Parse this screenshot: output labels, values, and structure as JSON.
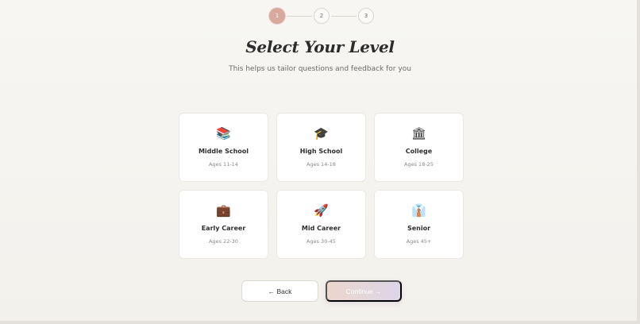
{
  "stepper": {
    "steps": [
      {
        "label": "1",
        "state": "active"
      },
      {
        "label": "2",
        "state": "inactive"
      },
      {
        "label": "3",
        "state": "inactive"
      }
    ]
  },
  "header": {
    "title": "Select Your Level",
    "subtitle": "This helps us tailor questions and feedback for you"
  },
  "levels": [
    {
      "icon": "📚",
      "icon_name": "books-icon",
      "title": "Middle School",
      "ages": "Ages 11-14"
    },
    {
      "icon": "🎓",
      "icon_name": "graduation-cap-icon",
      "title": "High School",
      "ages": "Ages 14-18"
    },
    {
      "icon": "🏛",
      "icon_name": "classical-building-icon",
      "title": "College",
      "ages": "Ages 18-25"
    },
    {
      "icon": "💼",
      "icon_name": "briefcase-icon",
      "title": "Early Career",
      "ages": "Ages 22-30"
    },
    {
      "icon": "🚀",
      "icon_name": "rocket-icon",
      "title": "Mid Career",
      "ages": "Ages 30-45"
    },
    {
      "icon": "👔",
      "icon_name": "necktie-shirt-icon",
      "title": "Senior",
      "ages": "Ages 45+"
    }
  ],
  "actions": {
    "back_label": "← Back",
    "continue_label": "Continue →"
  },
  "colors": {
    "accent": "#d9a9a0",
    "background": "#f6f4f0"
  }
}
